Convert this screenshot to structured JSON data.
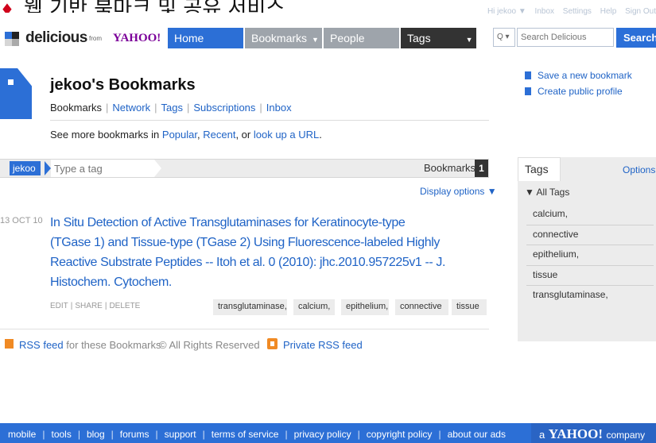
{
  "slide": {
    "title": "웹 기반 북마크 및 공유 서비스"
  },
  "util": [
    "Hi jekoo ▼",
    "Inbox",
    "Settings",
    "Help",
    "Sign Out"
  ],
  "brand": {
    "name": "delicious",
    "from": "from",
    "yahoo": "YAHOO!"
  },
  "nav": {
    "home": "Home",
    "bookmarks": "Bookmarks",
    "people": "People",
    "tags": "Tags"
  },
  "search": {
    "scope": "Q ▾",
    "placeholder": "Search Delicious",
    "button": "Search"
  },
  "profile": {
    "title": "jekoo's Bookmarks",
    "links": [
      "Bookmarks",
      "Network",
      "Tags",
      "Subscriptions",
      "Inbox"
    ],
    "see_more_prefix": "See more bookmarks in",
    "popular": "Popular",
    "recent": "Recent",
    "or": ", or",
    "lookup": "look up a URL",
    "period": "."
  },
  "side_actions": {
    "save": "Save a new bookmark",
    "public": "Create public profile"
  },
  "tagbar": {
    "user": "jekoo",
    "placeholder": "Type a tag",
    "bookmarks_label": "Bookmarks",
    "count": "1",
    "display_options": "Display options ▼"
  },
  "bookmark": {
    "date": "13 OCT 10",
    "title": "In Situ Detection of Active Transglutaminases for Keratinocyte-type (TGase 1) and Tissue-type (TGase 2) Using Fluorescence-labeled Highly Reactive Substrate Peptides -- Itoh et al. 0 (2010): jhc.2010.957225v1 -- J. Histochem. Cytochem.",
    "actions": [
      "EDIT",
      "SHARE",
      "DELETE"
    ],
    "tags": [
      "transglutaminase,",
      "calcium,",
      "epithelium,",
      "connective",
      "tissue"
    ]
  },
  "footer_links": {
    "rss": "RSS feed",
    "rss_suffix": "for these Bookmarks",
    "copyright": "© All Rights Reserved",
    "private_rss": "Private RSS feed"
  },
  "tags_panel": {
    "title": "Tags",
    "options": "Options ▾",
    "all_tags": "▼ All Tags",
    "items": [
      "calcium,",
      "connective",
      "epithelium,",
      "tissue",
      "transglutaminase,"
    ]
  },
  "bottom": {
    "links": [
      "mobile",
      "tools",
      "blog",
      "forums",
      "support",
      "terms of service",
      "privacy policy",
      "copyright policy",
      "about our ads"
    ],
    "company_prefix": "a",
    "company_brand": "YAHOO!",
    "company_suffix": "company"
  },
  "colors": {
    "accent": "#2c6fd6",
    "link": "#1f63c6",
    "yahoo": "#7b0099",
    "rss": "#f08a24",
    "nav_gray": "#9ea4ab",
    "nav_dark": "#333333"
  }
}
